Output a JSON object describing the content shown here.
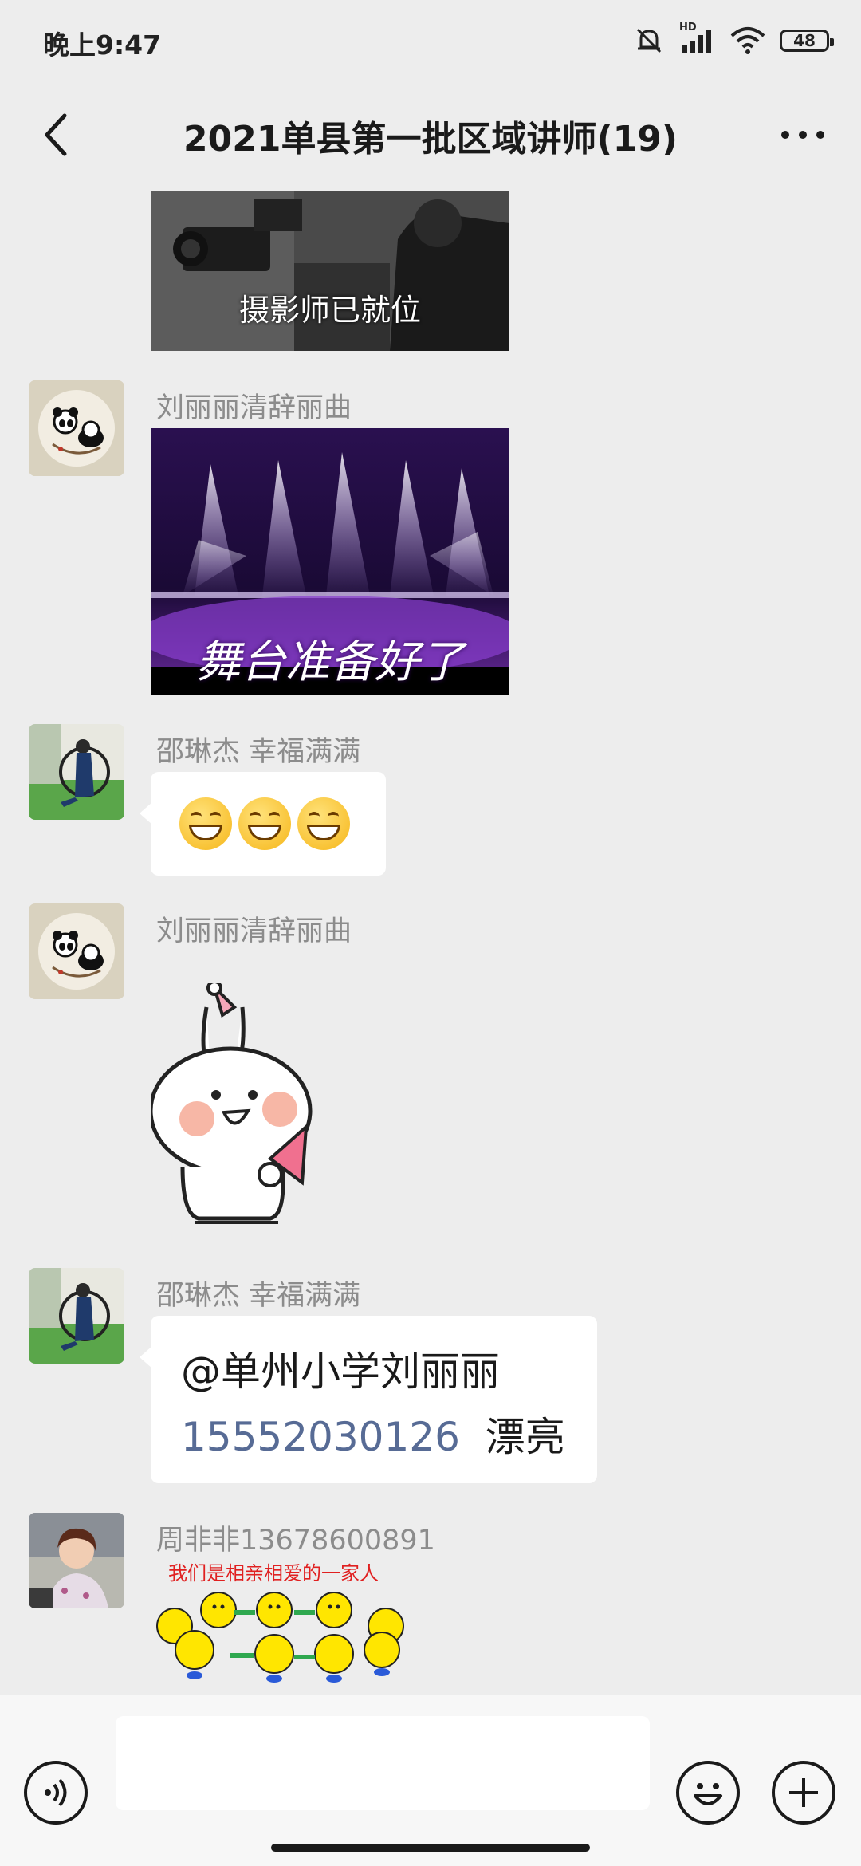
{
  "status_bar": {
    "time": "晚上9:47",
    "network_label": "HD",
    "battery": "48"
  },
  "header": {
    "title": "2021单县第一批区域讲师(19)",
    "back_icon": "chevron-left-icon",
    "more_icon": "more-dots-icon"
  },
  "messages": [
    {
      "type": "image",
      "caption": "摄影师已就位"
    },
    {
      "type": "image",
      "sender": "刘丽丽清辞丽曲",
      "caption": "舞台准备好了"
    },
    {
      "type": "emoji",
      "sender": "邵琳杰  幸福满满",
      "emojis": [
        "grinning-face",
        "grinning-face",
        "grinning-face"
      ]
    },
    {
      "type": "sticker",
      "sender": "刘丽丽清辞丽曲",
      "sticker": "party-bunny-sticker"
    },
    {
      "type": "text",
      "sender": "邵琳杰  幸福满满",
      "line1": "@单州小学刘丽丽",
      "phone": "15552030126",
      "suffix": "漂亮"
    },
    {
      "type": "sticker",
      "sender": "周非非13678600891",
      "sticker_caption": "我们是相亲相爱的一家人"
    }
  ],
  "input_bar": {
    "placeholder": "",
    "voice_icon": "voice-icon",
    "emoji_icon": "emoji-icon",
    "plus_icon": "plus-icon"
  }
}
